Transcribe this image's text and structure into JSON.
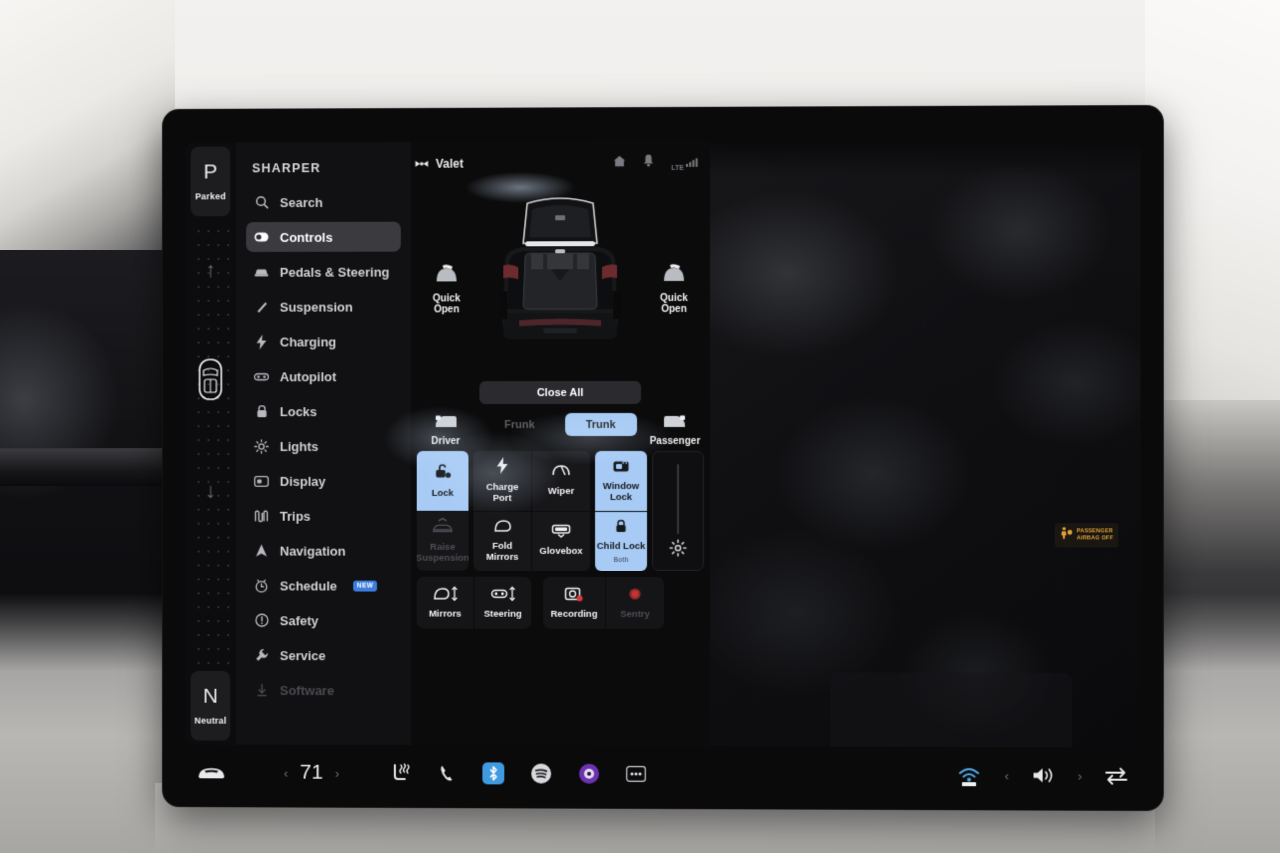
{
  "gear_strip": {
    "park_letter": "P",
    "park_label": "Parked",
    "neutral_letter": "N",
    "neutral_label": "Neutral",
    "up_arrow": "↑",
    "down_arrow": "↓"
  },
  "sidebar": {
    "app_title": "SHARPER",
    "items": [
      {
        "label": "Search",
        "icon": "search-icon"
      },
      {
        "label": "Controls",
        "icon": "toggle-icon",
        "active": true
      },
      {
        "label": "Pedals & Steering",
        "icon": "car-front-icon"
      },
      {
        "label": "Suspension",
        "icon": "suspension-icon"
      },
      {
        "label": "Charging",
        "icon": "bolt-icon"
      },
      {
        "label": "Autopilot",
        "icon": "autopilot-icon"
      },
      {
        "label": "Locks",
        "icon": "lock-icon"
      },
      {
        "label": "Lights",
        "icon": "light-icon"
      },
      {
        "label": "Display",
        "icon": "display-icon"
      },
      {
        "label": "Trips",
        "icon": "trips-icon"
      },
      {
        "label": "Navigation",
        "icon": "navigation-arrow-icon"
      },
      {
        "label": "Schedule",
        "icon": "clock-icon",
        "badge": "NEW"
      },
      {
        "label": "Safety",
        "icon": "warning-icon"
      },
      {
        "label": "Service",
        "icon": "wrench-icon"
      },
      {
        "label": "Software",
        "icon": "download-icon",
        "dim": true
      }
    ]
  },
  "statusbar": {
    "valet_label": "Valet",
    "valet_icon": "bowtie-icon",
    "home_icon": "home-icon",
    "bell_icon": "bell-icon",
    "network_label": "LTE",
    "signal_icon": "signal-bars-icon"
  },
  "controls": {
    "quick_open_left": "Quick\nOpen",
    "quick_open_left_line1": "Quick",
    "quick_open_left_line2": "Open",
    "quick_open_right_line1": "Quick",
    "quick_open_right_line2": "Open",
    "close_all_label": "Close All",
    "doors": {
      "driver_label": "Driver",
      "passenger_label": "Passenger",
      "frunk_label": "Frunk",
      "trunk_label": "Trunk",
      "trunk_active": true
    },
    "grid": [
      {
        "label": "Charge\nPort",
        "line1": "Charge",
        "line2": "Port",
        "icon": "bolt-icon",
        "state": "off"
      },
      {
        "label": "Wiper",
        "line1": "Wiper",
        "line2": "",
        "icon": "wiper-icon",
        "state": "off"
      },
      {
        "label": "Fold\nMirrors",
        "line1": "Fold",
        "line2": "Mirrors",
        "icon": "mirror-icon",
        "state": "off"
      },
      {
        "label": "Glovebox",
        "line1": "Glovebox",
        "line2": "",
        "icon": "glovebox-icon",
        "state": "off"
      },
      {
        "label": "Raise\nSuspension",
        "line1": "Raise",
        "line2": "Suspension",
        "icon": "raise-suspension-icon",
        "state": "disabled"
      }
    ],
    "lock_button": {
      "label": "Lock",
      "icon": "unlock-icon",
      "state": "on"
    },
    "window_lock": {
      "line1": "Window",
      "line2": "Lock",
      "icon": "window-lock-icon",
      "state": "on"
    },
    "child_lock": {
      "label": "Child Lock",
      "sub": "Both",
      "icon": "child-lock-icon",
      "state": "on"
    },
    "pairs": [
      {
        "label": "Mirrors",
        "icon": "mirror-adjust-icon",
        "state": "off"
      },
      {
        "label": "Steering",
        "icon": "steering-adjust-icon",
        "state": "off"
      },
      {
        "label": "Recording",
        "icon": "dashcam-icon",
        "state": "off"
      },
      {
        "label": "Sentry",
        "icon": "sentry-icon",
        "state": "disabled"
      }
    ],
    "brightness": {
      "icon": "brightness-sun-icon",
      "value": 0
    }
  },
  "map": {
    "airbag_line1": "PASSENGER",
    "airbag_line2": "AIRBAG",
    "airbag_state": "OFF",
    "airbag_icon": "passenger-airbag-icon"
  },
  "taskbar": {
    "car_icon": "car-icon",
    "temperature": "71",
    "prev_chevron": "‹",
    "next_chevron": "›",
    "seat_heater_icon": "seat-heater-icon",
    "phone_icon": "phone-icon",
    "bluetooth_icon": "bluetooth-icon",
    "spotify_icon": "spotify-icon",
    "media_icon": "media-app-icon",
    "more_icon": "more-dots-icon",
    "radio_icon": "radio-wifi-icon",
    "volume_icon": "volume-icon",
    "vol_prev": "‹",
    "vol_next": "›",
    "swap_icon": "swap-arrows-icon"
  },
  "colors": {
    "accent_blue": "#a7cbf5",
    "badge_blue": "#3b7de0",
    "amber": "#e0a134",
    "panel_bg": "#0b0b0c",
    "sidebar_bg": "#111113"
  }
}
